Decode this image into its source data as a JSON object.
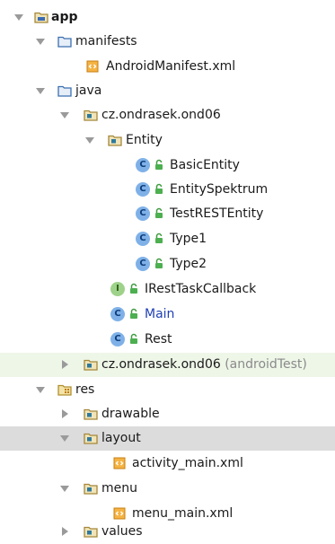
{
  "tree": {
    "app": "app",
    "manifests": "manifests",
    "manifest_file": "AndroidManifest.xml",
    "java": "java",
    "pkg_main": "cz.ondrasek.ond06",
    "entity": "Entity",
    "classes": [
      "BasicEntity",
      "EntitySpektrum",
      "TestRESTEntity",
      "Type1",
      "Type2"
    ],
    "iface": "IRestTaskCallback",
    "main_class": "Main",
    "rest_class": "Rest",
    "pkg_test": "cz.ondrasek.ond06",
    "pkg_test_suffix": "(androidTest)",
    "res": "res",
    "drawable": "drawable",
    "layout": "layout",
    "activity_xml": "activity_main.xml",
    "menu": "menu",
    "menu_xml": "menu_main.xml",
    "values": "values"
  },
  "badges": {
    "class_letter": "C",
    "interface_letter": "I"
  },
  "colors": {
    "selected_row": "#dcdcdc",
    "test_row": "#eef6e8",
    "class_badge": "#7fb1e8",
    "interface_badge": "#9ed28a",
    "main_link": "#1f3fb4"
  }
}
